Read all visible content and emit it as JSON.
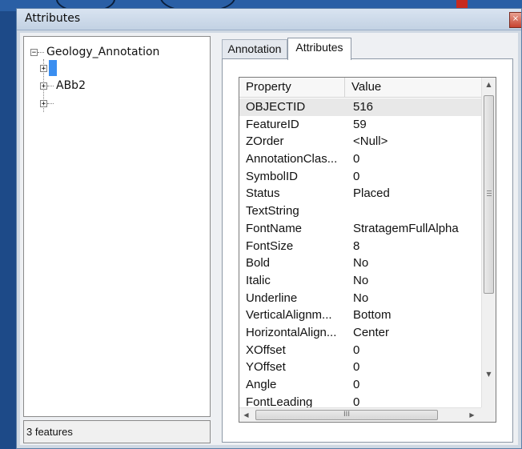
{
  "window": {
    "title": "Attributes",
    "close_glyph": "×"
  },
  "tree": {
    "root_label": "Geology_Annotation",
    "root_expander": "−",
    "children": [
      {
        "label": "",
        "expander": "+"
      },
      {
        "label": "ABb2",
        "expander": "+"
      },
      {
        "label": "",
        "expander": "+"
      }
    ]
  },
  "status_bar": {
    "text": "3 features"
  },
  "tabs": [
    {
      "label": "Annotation",
      "active": false
    },
    {
      "label": "Attributes",
      "active": true
    }
  ],
  "grid": {
    "columns": {
      "property": "Property",
      "value": "Value"
    },
    "rows": [
      {
        "property": "OBJECTID",
        "value": "516"
      },
      {
        "property": "FeatureID",
        "value": "59"
      },
      {
        "property": "ZOrder",
        "value": "<Null>"
      },
      {
        "property": "AnnotationClas...",
        "value": "0"
      },
      {
        "property": "SymbolID",
        "value": "0"
      },
      {
        "property": "Status",
        "value": "Placed"
      },
      {
        "property": "TextString",
        "value": ""
      },
      {
        "property": "FontName",
        "value": "StratagemFullAlpha"
      },
      {
        "property": "FontSize",
        "value": "8"
      },
      {
        "property": "Bold",
        "value": "No"
      },
      {
        "property": "Italic",
        "value": "No"
      },
      {
        "property": "Underline",
        "value": "No"
      },
      {
        "property": "VerticalAlignm...",
        "value": "Bottom"
      },
      {
        "property": "HorizontalAlign...",
        "value": "Center"
      },
      {
        "property": "XOffset",
        "value": "0"
      },
      {
        "property": "YOffset",
        "value": "0"
      },
      {
        "property": "Angle",
        "value": "0"
      },
      {
        "property": "FontLeading",
        "value": "0"
      }
    ],
    "selected_row": 0
  },
  "scrollbars": {
    "up": "▲",
    "down": "▼",
    "left": "◀",
    "right": "▶",
    "hgrip": "III"
  },
  "colors": {
    "selection": "#3a8ef0",
    "window_frame": "#cfd8e3"
  }
}
